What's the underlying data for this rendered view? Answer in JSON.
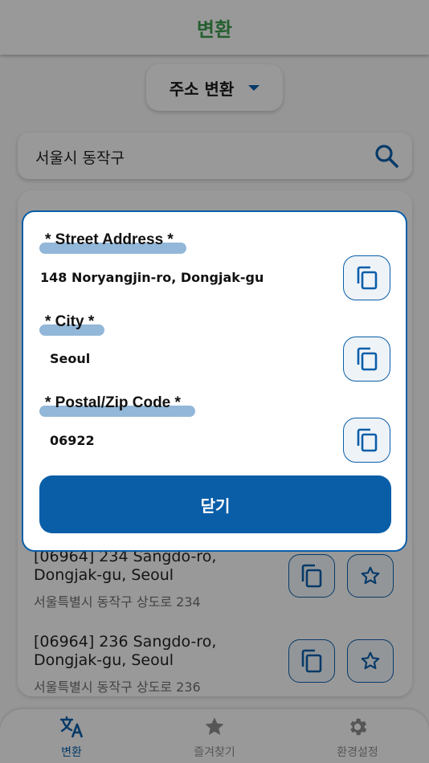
{
  "header": {
    "title": "변환"
  },
  "mode_selector": {
    "label": "주소 변환"
  },
  "search": {
    "value": "서울시 동작구"
  },
  "results": [
    {
      "english": "[06964] 234 Sangdo-ro, Dongjak-gu, Seoul",
      "korean": "서울특별시 동작구 상도로 234"
    },
    {
      "english": "[06964] 236 Sangdo-ro, Dongjak-gu, Seoul",
      "korean": "서울특별시 동작구 상도로 236"
    }
  ],
  "dialog": {
    "fields": [
      {
        "label": "* Street Address *",
        "value": "148 Noryangjin-ro, Dongjak-gu"
      },
      {
        "label": "* City *",
        "value": "Seoul"
      },
      {
        "label": "* Postal/Zip Code *",
        "value": "06922"
      }
    ],
    "close_label": "닫기"
  },
  "bottom_nav": {
    "items": [
      {
        "label": "변환",
        "icon": "translate-icon",
        "active": true
      },
      {
        "label": "즐겨찾기",
        "icon": "star-icon",
        "active": false
      },
      {
        "label": "환경설정",
        "icon": "gear-icon",
        "active": false
      }
    ]
  },
  "colors": {
    "primary": "#0a5ea8",
    "title_green": "#3c9a4e",
    "highlight": "#92b7d8"
  }
}
